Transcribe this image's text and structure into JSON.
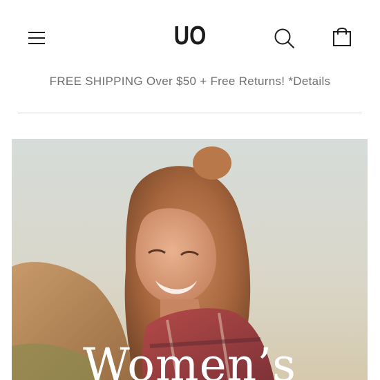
{
  "header": {
    "logo_text": "UO",
    "icons": {
      "menu": "hamburger-menu-icon",
      "search": "search-icon",
      "cart": "shopping-bag-icon"
    }
  },
  "promo": {
    "text": "FREE SHIPPING Over $50 + Free Returns! *Details"
  },
  "hero": {
    "title": "Women’s"
  },
  "colors": {
    "icon": "#1c1c1c",
    "promo_text": "#6f6f6f",
    "divider": "#d6d6d6",
    "hero_title": "#ffffff"
  }
}
